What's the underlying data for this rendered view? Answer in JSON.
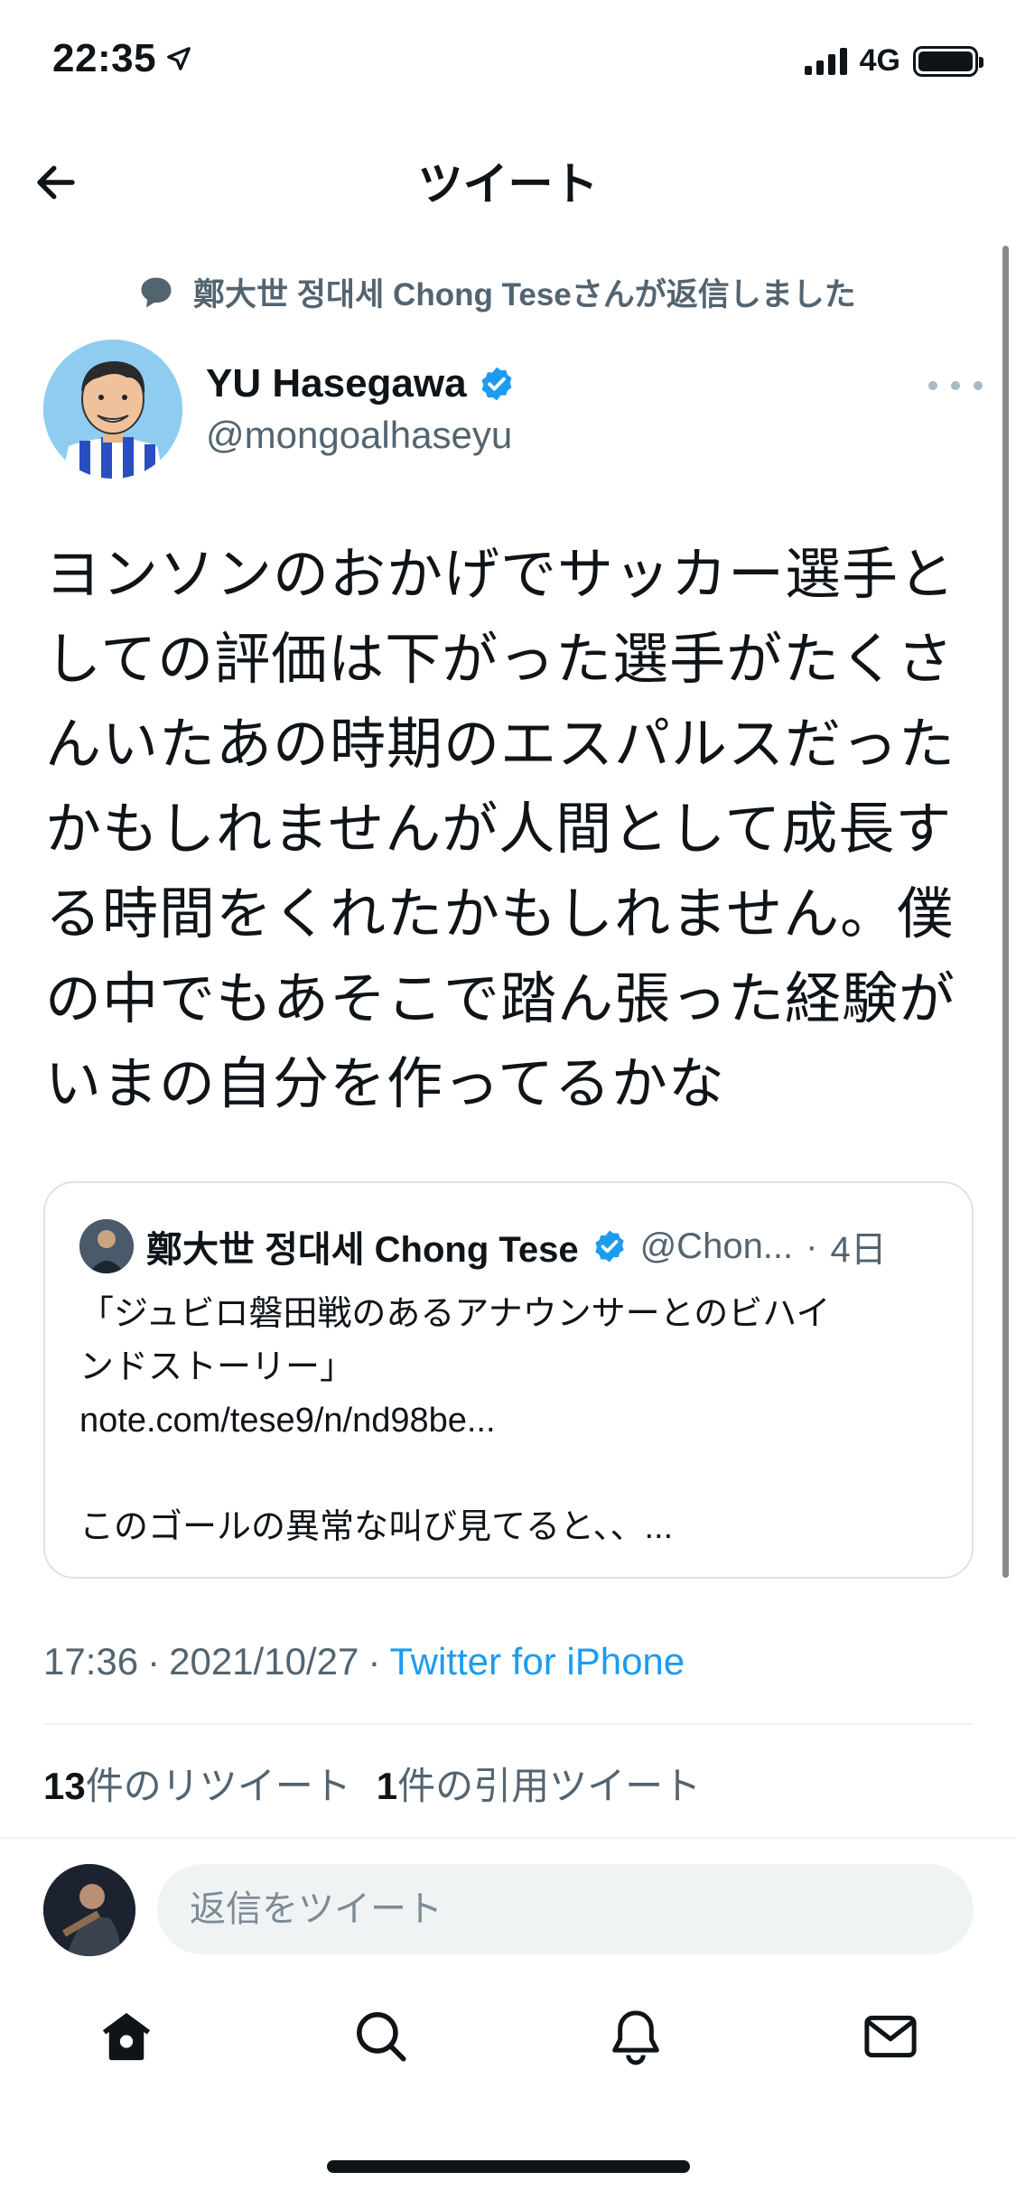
{
  "status_bar": {
    "time": "22:35",
    "network": "4G",
    "battery_level": 1.0
  },
  "header": {
    "title": "ツイート"
  },
  "tweet": {
    "retweet_note": "鄭大世 정대세 Chong Teseさんが返信しました",
    "author_name": "YU Hasegawa",
    "author_handle": "@mongoalhaseyu",
    "text_lines": [
      "ヨンソンのおかげでサッカー選手と",
      "しての評価は下がった選手がたくさ",
      "んいたあの時期のエスパルスだった",
      "かもしれませんが人間として成長す",
      "る時間をくれたかもしれません。僕",
      "の中でもあそこで踏ん張った経験が",
      "いまの自分を作ってるかな"
    ],
    "quote": {
      "name": "鄭大世 정대세 Chong Tese",
      "handle": "@Chon...",
      "separator": "·",
      "date": "4日",
      "lines": [
        "「ジュビロ磐田戦のあるアナウンサーとのビハイ",
        "ンドストーリー」",
        "note.com/tese9/n/nd98be...",
        "",
        "このゴールの異常な叫び見てると、、..."
      ]
    },
    "time": "17:36",
    "date": "2021/10/27",
    "separator": "·",
    "source": "Twitter for iPhone",
    "retweets_count": "13",
    "retweets_label": "件のリツイート",
    "quotes_count": "1",
    "quotes_label": "件の引用ツイート"
  },
  "reply": {
    "placeholder": "返信をツイート"
  },
  "tab_bar": {
    "items": [
      "home-icon",
      "search-icon",
      "notifications-icon",
      "messages-icon"
    ]
  },
  "colors": {
    "accent": "#1d9bf0",
    "text": "#0f1419",
    "secondary": "#536471",
    "avatar_bg": "#8ecdf0"
  }
}
